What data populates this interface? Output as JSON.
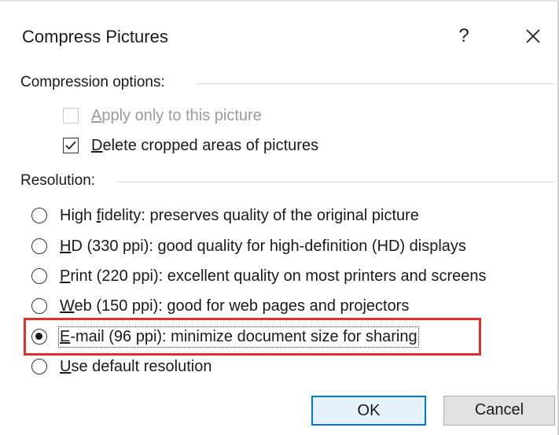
{
  "dialog": {
    "title": "Compress Pictures",
    "help_label": "?",
    "close_icon": "close-icon"
  },
  "compression": {
    "group_label": "Compression options:",
    "options": [
      {
        "prefix": "",
        "key": "A",
        "rest": "pply only to this picture",
        "checked": false,
        "disabled": true
      },
      {
        "prefix": "",
        "key": "D",
        "rest": "elete cropped areas of pictures",
        "checked": true,
        "disabled": false
      }
    ]
  },
  "resolution": {
    "group_label": "Resolution:",
    "options": [
      {
        "prefix": "High ",
        "key": "f",
        "rest": "idelity: preserves quality of the original picture",
        "selected": false
      },
      {
        "prefix": "",
        "key": "H",
        "rest": "D (330 ppi): good quality for high-definition (HD) displays",
        "selected": false
      },
      {
        "prefix": "",
        "key": "P",
        "rest": "rint (220 ppi): excellent quality on most printers and screens",
        "selected": false
      },
      {
        "prefix": "",
        "key": "W",
        "rest": "eb (150 ppi): good for web pages and projectors",
        "selected": false
      },
      {
        "prefix": "",
        "key": "E",
        "rest": "-mail (96 ppi): minimize document size for sharing",
        "selected": true
      },
      {
        "prefix": "",
        "key": "U",
        "rest": "se default resolution",
        "selected": false
      }
    ]
  },
  "buttons": {
    "ok_label": "OK",
    "cancel_label": "Cancel"
  },
  "colors": {
    "highlight": "#e03030",
    "primary_border": "#0078d7"
  }
}
